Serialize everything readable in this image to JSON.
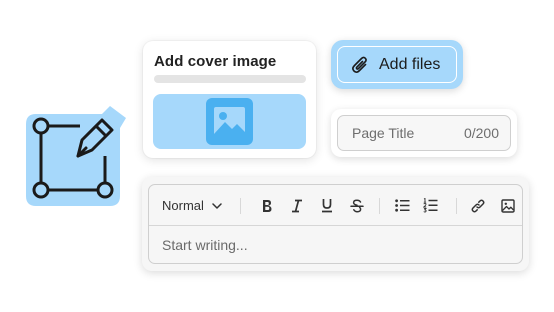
{
  "cover_card": {
    "title": "Add cover image",
    "icon": "image-icon"
  },
  "files_button": {
    "label": "Add files",
    "icon": "paperclip-icon"
  },
  "title_field": {
    "placeholder": "Page Title",
    "counter": "0/200"
  },
  "editor": {
    "toolbar": {
      "style_select": "Normal",
      "buttons": [
        "bold",
        "italic",
        "underline",
        "strikethrough",
        "bulleted-list",
        "numbered-list",
        "link",
        "image"
      ]
    },
    "placeholder": "Start writing..."
  },
  "colors": {
    "accent": "#a6d8fb",
    "accent_dark": "#4ab0f0",
    "text": "#222222"
  }
}
